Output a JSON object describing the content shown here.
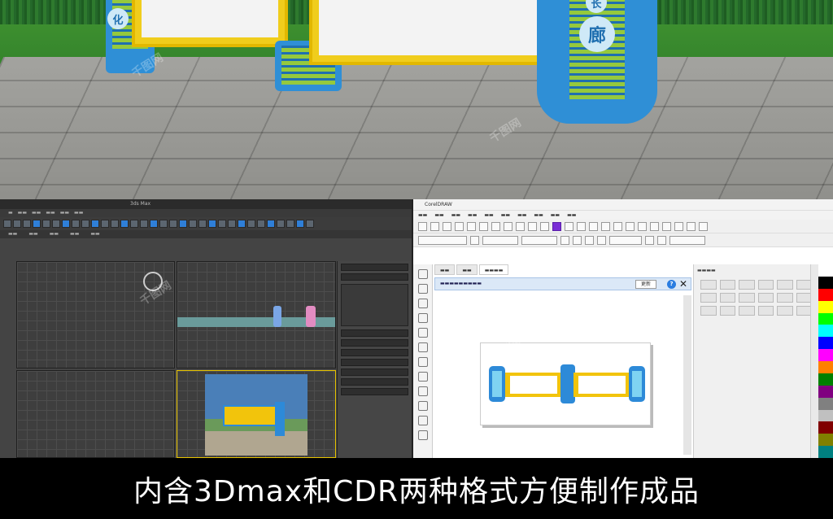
{
  "scene": {
    "badge_left": "化",
    "badge_right": "廊",
    "badge_right_top": "长"
  },
  "max_window": {
    "title": "3ds Max",
    "toolbar_accent": "#2f7fd8",
    "viewport_border_active": "#e7c300"
  },
  "cdr_window": {
    "title": "CorelDRAW",
    "hint_button": "更新",
    "close_glyph": "✕",
    "help_glyph": "?",
    "tool_accent": "#7a2ed6",
    "drawing_colors": {
      "yellow": "#f2c40c",
      "blue": "#2d8ad8",
      "cyan": "#7fd3f2"
    }
  },
  "caption": {
    "text": "内含3Dmax和CDR两种格式方便制作成品"
  },
  "watermark": "千图网",
  "palette_colors": [
    "#ffffff",
    "#000000",
    "#ff0000",
    "#ffff00",
    "#00ff00",
    "#00ffff",
    "#0000ff",
    "#ff00ff",
    "#ff8000",
    "#008000",
    "#800080",
    "#808080",
    "#c0c0c0",
    "#800000",
    "#808000",
    "#008080"
  ]
}
